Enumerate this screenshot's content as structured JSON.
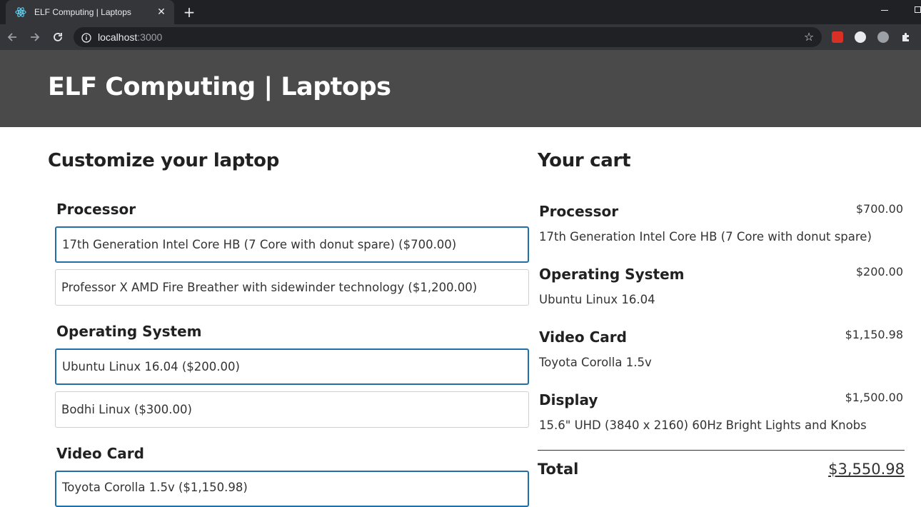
{
  "browser": {
    "tab_title": "ELF Computing | Laptops",
    "url_host": "localhost",
    "url_port": ":3000"
  },
  "header": {
    "title": "ELF Computing | Laptops"
  },
  "customize": {
    "heading": "Customize your laptop",
    "features": [
      {
        "title": "Processor",
        "options": [
          {
            "label": "17th Generation Intel Core HB (7 Core with donut spare) ($700.00)",
            "selected": true
          },
          {
            "label": "Professor X AMD Fire Breather with sidewinder technology ($1,200.00)",
            "selected": false
          }
        ]
      },
      {
        "title": "Operating System",
        "options": [
          {
            "label": "Ubuntu Linux 16.04 ($200.00)",
            "selected": true
          },
          {
            "label": "Bodhi Linux ($300.00)",
            "selected": false
          }
        ]
      },
      {
        "title": "Video Card",
        "options": [
          {
            "label": "Toyota Corolla 1.5v ($1,150.98)",
            "selected": true
          }
        ]
      }
    ]
  },
  "cart": {
    "heading": "Your cart",
    "items": [
      {
        "feature": "Processor",
        "name": "17th Generation Intel Core HB (7 Core with donut spare)",
        "price": "$700.00"
      },
      {
        "feature": "Operating System",
        "name": "Ubuntu Linux 16.04",
        "price": "$200.00"
      },
      {
        "feature": "Video Card",
        "name": "Toyota Corolla 1.5v",
        "price": "$1,150.98"
      },
      {
        "feature": "Display",
        "name": "15.6\" UHD (3840 x 2160) 60Hz Bright Lights and Knobs",
        "price": "$1,500.00"
      }
    ],
    "total_label": "Total",
    "total_value": "$3,550.98"
  },
  "colors": {
    "header_bg": "#4a4a4a",
    "selected_border": "#1f6fa9"
  },
  "icons": [
    "react-favicon-icon",
    "close-icon",
    "plus-icon",
    "back-arrow-icon",
    "forward-arrow-icon",
    "reload-icon",
    "info-icon",
    "star-icon",
    "extension-icon",
    "puzzle-icon"
  ]
}
